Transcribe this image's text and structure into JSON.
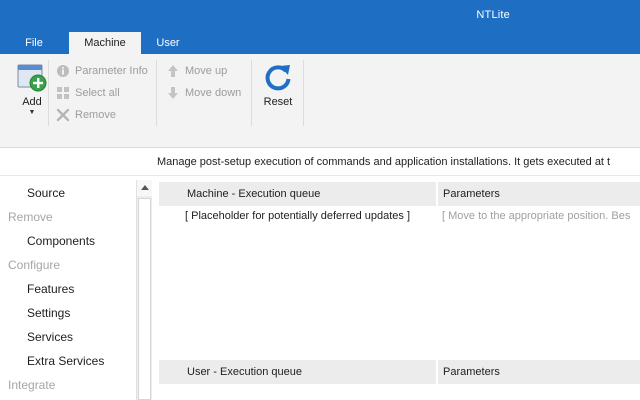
{
  "window": {
    "title": "NTLite"
  },
  "tabs": {
    "file": "File",
    "machine": "Machine",
    "user": "User"
  },
  "ribbon": {
    "add": "Add",
    "parameter_info": "Parameter Info",
    "select_all": "Select all",
    "remove": "Remove",
    "move_up": "Move up",
    "move_down": "Move down",
    "reset": "Reset"
  },
  "description": "Manage post-setup execution of commands and application installations. It gets executed at t",
  "sidebar": {
    "source": "Source",
    "remove_group": "Remove",
    "components": "Components",
    "configure_group": "Configure",
    "features": "Features",
    "settings": "Settings",
    "services": "Services",
    "extra_services": "Extra Services",
    "integrate_group": "Integrate"
  },
  "machine_grid": {
    "col1": "Machine - Execution queue",
    "col2": "Parameters",
    "row1_name": "[ Placeholder for potentially deferred updates ]",
    "row1_params": "[ Move to the appropriate position. Bes"
  },
  "user_grid": {
    "col1": "User - Execution queue",
    "col2": "Parameters"
  },
  "colors": {
    "accent": "#1e6fc4",
    "ribbon_bg": "#f3f3f3",
    "disabled": "#9c9c9c"
  }
}
